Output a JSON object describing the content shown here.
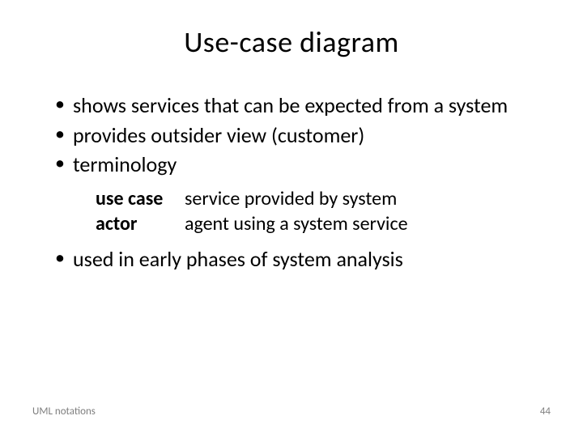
{
  "title": "Use-case diagram",
  "bullets": {
    "b1": "shows services that can be expected from a system",
    "b2": "provides outsider view (customer)",
    "b3": "terminology",
    "b4": "used in early phases of system analysis"
  },
  "defs": {
    "t1": "use case",
    "d1": "service provided by system",
    "t2": "actor",
    "d2": "agent using a system service"
  },
  "footer": {
    "left": "UML notations",
    "right": "44"
  }
}
